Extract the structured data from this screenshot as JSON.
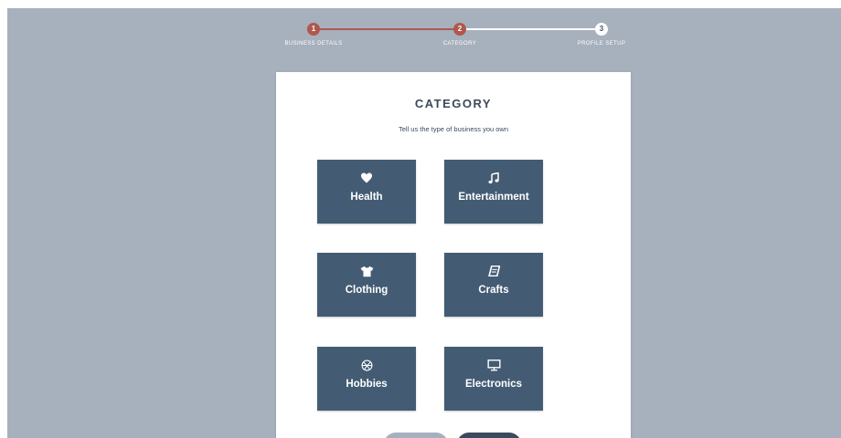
{
  "stepper": {
    "steps": [
      {
        "number": "1",
        "label": "BUSINESS DETAILS",
        "state": "completed"
      },
      {
        "number": "2",
        "label": "CATEGORY",
        "state": "active"
      },
      {
        "number": "3",
        "label": "PROFILE SETUP",
        "state": "pending"
      }
    ]
  },
  "card": {
    "title": "CATEGORY",
    "subtitle": "Tell us the type of business you own"
  },
  "categories": [
    {
      "label": "Health",
      "icon": "heart-icon"
    },
    {
      "label": "Entertainment",
      "icon": "music-note-icon"
    },
    {
      "label": "Clothing",
      "icon": "tshirt-icon"
    },
    {
      "label": "Crafts",
      "icon": "book-icon"
    },
    {
      "label": "Hobbies",
      "icon": "basketball-icon"
    },
    {
      "label": "Electronics",
      "icon": "monitor-icon"
    }
  ],
  "colors": {
    "background": "#a7b0bd",
    "accent": "#b0574d",
    "tile": "#435c73",
    "text": "#3b4a5c"
  }
}
